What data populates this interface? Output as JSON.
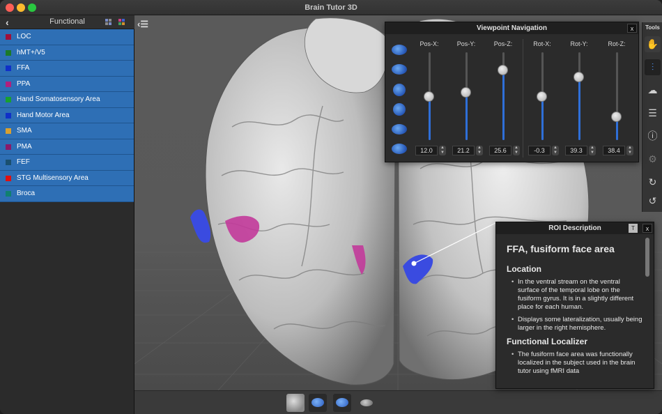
{
  "app": {
    "title": "Brain Tutor 3D"
  },
  "sidebar": {
    "title": "Functional",
    "items": [
      {
        "label": "LOC",
        "color": "#a0103a"
      },
      {
        "label": "hMT+/V5",
        "color": "#1b7a2a"
      },
      {
        "label": "FFA",
        "color": "#1030c8"
      },
      {
        "label": "PPA",
        "color": "#b0207e"
      },
      {
        "label": "Hand Somatosensory Area",
        "color": "#18a030"
      },
      {
        "label": "Hand Motor Area",
        "color": "#1030c8"
      },
      {
        "label": "SMA",
        "color": "#d8a030"
      },
      {
        "label": "PMA",
        "color": "#8a1a6a"
      },
      {
        "label": "FEF",
        "color": "#1a5070"
      },
      {
        "label": "STG Multisensory Area",
        "color": "#e01010"
      },
      {
        "label": "Broca",
        "color": "#108070"
      }
    ]
  },
  "tools": {
    "label": "Tools",
    "buttons": [
      "hand-icon",
      "sliders-icon",
      "brain-icon",
      "menu-icon",
      "info-icon",
      "gear-icon",
      "redo-icon",
      "undo-icon"
    ]
  },
  "viewpoint": {
    "title": "Viewpoint Navigation",
    "close": "x",
    "sliders": [
      {
        "label": "Pos-X:",
        "value": "12.0",
        "level": 0.5
      },
      {
        "label": "Pos-Y:",
        "value": "21.2",
        "level": 0.55
      },
      {
        "label": "Pos-Z:",
        "value": "25.6",
        "level": 0.8
      },
      {
        "label": "Rot-X:",
        "value": "-0.3",
        "level": 0.5
      },
      {
        "label": "Rot-Y:",
        "value": "39.3",
        "level": 0.72
      },
      {
        "label": "Rot-Z:",
        "value": "38.4",
        "level": 0.27
      }
    ]
  },
  "roi_description": {
    "title": "ROI Description",
    "t_button": "T",
    "close": "x",
    "heading": "FFA, fusiform face area",
    "location_heading": "Location",
    "location_items": [
      "In the ventral stream on the ventral surface of the temporal lobe on the fusiform gyrus. It is in a slightly different place for each human.",
      "Displays some lateralization, usually being larger in the right hemisphere."
    ],
    "localizer_heading": "Functional Localizer",
    "localizer_items": [
      "The fusiform face area was functionally localized in the subject used in the brain tutor using fMRI data"
    ]
  },
  "colors": {
    "accent": "#2e6fb5",
    "slider_fill": "#2f6fd8"
  }
}
